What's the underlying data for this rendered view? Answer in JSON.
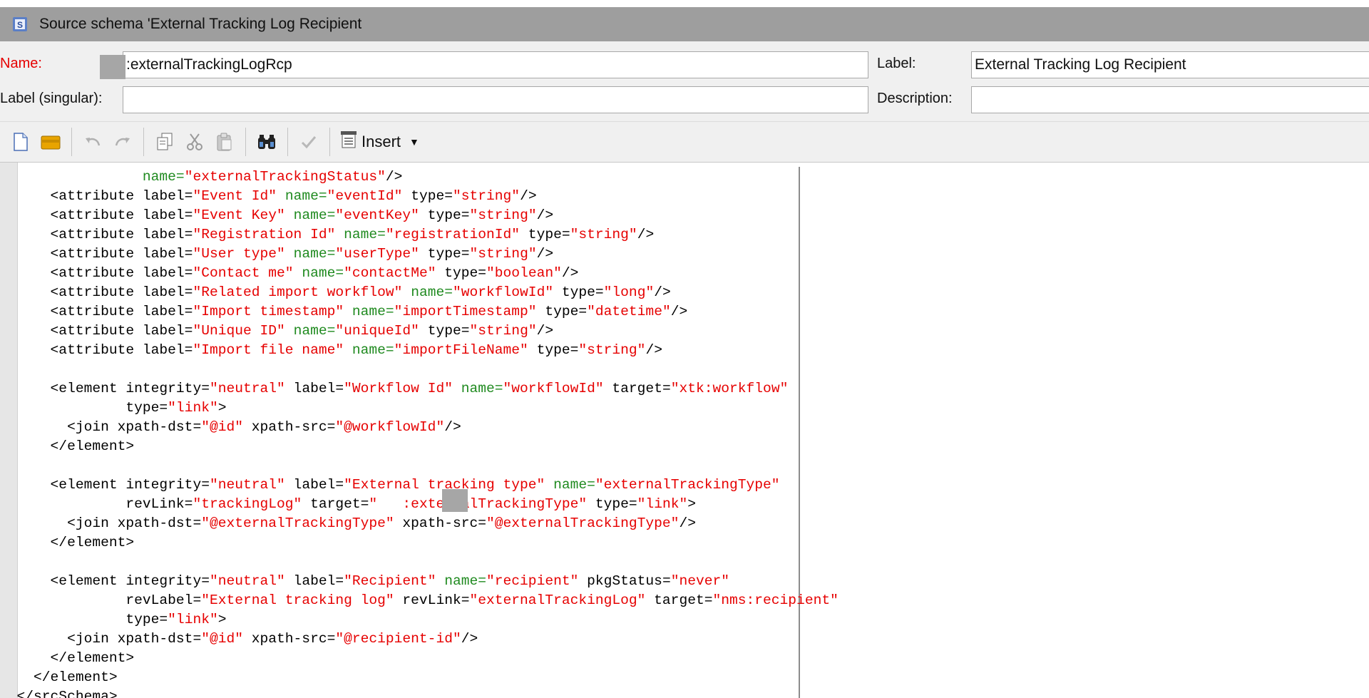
{
  "window": {
    "title": "Source schema 'External Tracking Log Recipient",
    "icon": "schema-icon"
  },
  "form": {
    "name_label": "Name:",
    "name_value": ":externalTrackingLogRcp",
    "label_label": "Label:",
    "label_value": "External Tracking Log Recipient",
    "singular_label": "Label (singular):",
    "singular_value": "",
    "description_label": "Description:",
    "description_value": ""
  },
  "toolbar": {
    "insert_label": "Insert",
    "buttons": [
      "new-icon",
      "open-icon",
      "undo-icon",
      "redo-icon",
      "copy-icon",
      "cut-icon",
      "paste-icon",
      "find-icon",
      "check-icon",
      "insert-icon"
    ]
  },
  "colors": {
    "attribute_name": "#1f8a1f",
    "attribute_value": "#e60000",
    "title_bar": "#9e9e9e",
    "name_label": "#e60000"
  },
  "code_lines": [
    [
      [
        "t",
        "                 "
      ],
      [
        "a",
        "name="
      ],
      [
        "v",
        "\"externalTrackingStatus\""
      ],
      [
        "t",
        "/>"
      ]
    ],
    [
      [
        "t",
        "      <attribute "
      ],
      [
        "t",
        "label="
      ],
      [
        "v",
        "\"Event Id\""
      ],
      [
        "t",
        " "
      ],
      [
        "a",
        "name="
      ],
      [
        "v",
        "\"eventId\""
      ],
      [
        "t",
        " type="
      ],
      [
        "v",
        "\"string\""
      ],
      [
        "t",
        "/>"
      ]
    ],
    [
      [
        "t",
        "      <attribute "
      ],
      [
        "t",
        "label="
      ],
      [
        "v",
        "\"Event Key\""
      ],
      [
        "t",
        " "
      ],
      [
        "a",
        "name="
      ],
      [
        "v",
        "\"eventKey\""
      ],
      [
        "t",
        " type="
      ],
      [
        "v",
        "\"string\""
      ],
      [
        "t",
        "/>"
      ]
    ],
    [
      [
        "t",
        "      <attribute "
      ],
      [
        "t",
        "label="
      ],
      [
        "v",
        "\"Registration Id\""
      ],
      [
        "t",
        " "
      ],
      [
        "a",
        "name="
      ],
      [
        "v",
        "\"registrationId\""
      ],
      [
        "t",
        " type="
      ],
      [
        "v",
        "\"string\""
      ],
      [
        "t",
        "/>"
      ]
    ],
    [
      [
        "t",
        "      <attribute "
      ],
      [
        "t",
        "label="
      ],
      [
        "v",
        "\"User type\""
      ],
      [
        "t",
        " "
      ],
      [
        "a",
        "name="
      ],
      [
        "v",
        "\"userType\""
      ],
      [
        "t",
        " type="
      ],
      [
        "v",
        "\"string\""
      ],
      [
        "t",
        "/>"
      ]
    ],
    [
      [
        "t",
        "      <attribute "
      ],
      [
        "t",
        "label="
      ],
      [
        "v",
        "\"Contact me\""
      ],
      [
        "t",
        " "
      ],
      [
        "a",
        "name="
      ],
      [
        "v",
        "\"contactMe\""
      ],
      [
        "t",
        " type="
      ],
      [
        "v",
        "\"boolean\""
      ],
      [
        "t",
        "/>"
      ]
    ],
    [
      [
        "t",
        "      <attribute "
      ],
      [
        "t",
        "label="
      ],
      [
        "v",
        "\"Related import workflow\""
      ],
      [
        "t",
        " "
      ],
      [
        "a",
        "name="
      ],
      [
        "v",
        "\"workflowId\""
      ],
      [
        "t",
        " type="
      ],
      [
        "v",
        "\"long\""
      ],
      [
        "t",
        "/>"
      ]
    ],
    [
      [
        "t",
        "      <attribute "
      ],
      [
        "t",
        "label="
      ],
      [
        "v",
        "\"Import timestamp\""
      ],
      [
        "t",
        " "
      ],
      [
        "a",
        "name="
      ],
      [
        "v",
        "\"importTimestamp\""
      ],
      [
        "t",
        " type="
      ],
      [
        "v",
        "\"datetime\""
      ],
      [
        "t",
        "/>"
      ]
    ],
    [
      [
        "t",
        "      <attribute "
      ],
      [
        "t",
        "label="
      ],
      [
        "v",
        "\"Unique ID\""
      ],
      [
        "t",
        " "
      ],
      [
        "a",
        "name="
      ],
      [
        "v",
        "\"uniqueId\""
      ],
      [
        "t",
        " type="
      ],
      [
        "v",
        "\"string\""
      ],
      [
        "t",
        "/>"
      ]
    ],
    [
      [
        "t",
        "      <attribute "
      ],
      [
        "t",
        "label="
      ],
      [
        "v",
        "\"Import file name\""
      ],
      [
        "t",
        " "
      ],
      [
        "a",
        "name="
      ],
      [
        "v",
        "\"importFileName\""
      ],
      [
        "t",
        " type="
      ],
      [
        "v",
        "\"string\""
      ],
      [
        "t",
        "/>"
      ]
    ],
    [
      [
        "t",
        ""
      ]
    ],
    [
      [
        "t",
        "      <element integrity="
      ],
      [
        "v",
        "\"neutral\""
      ],
      [
        "t",
        " label="
      ],
      [
        "v",
        "\"Workflow Id\""
      ],
      [
        "t",
        " "
      ],
      [
        "a",
        "name="
      ],
      [
        "v",
        "\"workflowId\""
      ],
      [
        "t",
        " target="
      ],
      [
        "v",
        "\"xtk:workflow\""
      ]
    ],
    [
      [
        "t",
        "               type="
      ],
      [
        "v",
        "\"link\""
      ],
      [
        "t",
        ">"
      ]
    ],
    [
      [
        "t",
        "        <join xpath-dst="
      ],
      [
        "v",
        "\"@id\""
      ],
      [
        "t",
        " xpath-src="
      ],
      [
        "v",
        "\"@workflowId\""
      ],
      [
        "t",
        "/>"
      ]
    ],
    [
      [
        "t",
        "      </element>"
      ]
    ],
    [
      [
        "t",
        ""
      ]
    ],
    [
      [
        "t",
        "      <element integrity="
      ],
      [
        "v",
        "\"neutral\""
      ],
      [
        "t",
        " label="
      ],
      [
        "v",
        "\"External tracking type\""
      ],
      [
        "t",
        " "
      ],
      [
        "a",
        "name="
      ],
      [
        "v",
        "\"externalTrackingType\""
      ]
    ],
    [
      [
        "t",
        "               revLink="
      ],
      [
        "v",
        "\"trackingLog\""
      ],
      [
        "t",
        " target="
      ],
      [
        "v",
        "\"   :externalTrackingType\""
      ],
      [
        "t",
        " type="
      ],
      [
        "v",
        "\"link\""
      ],
      [
        "t",
        ">"
      ]
    ],
    [
      [
        "t",
        "        <join xpath-dst="
      ],
      [
        "v",
        "\"@externalTrackingType\""
      ],
      [
        "t",
        " xpath-src="
      ],
      [
        "v",
        "\"@externalTrackingType\""
      ],
      [
        "t",
        "/>"
      ]
    ],
    [
      [
        "t",
        "      </element>"
      ]
    ],
    [
      [
        "t",
        ""
      ]
    ],
    [
      [
        "t",
        "      <element integrity="
      ],
      [
        "v",
        "\"neutral\""
      ],
      [
        "t",
        " label="
      ],
      [
        "v",
        "\"Recipient\""
      ],
      [
        "t",
        " "
      ],
      [
        "a",
        "name="
      ],
      [
        "v",
        "\"recipient\""
      ],
      [
        "t",
        " pkgStatus="
      ],
      [
        "v",
        "\"never\""
      ]
    ],
    [
      [
        "t",
        "               revLabel="
      ],
      [
        "v",
        "\"External tracking log\""
      ],
      [
        "t",
        " revLink="
      ],
      [
        "v",
        "\"externalTrackingLog\""
      ],
      [
        "t",
        " target="
      ],
      [
        "v",
        "\"nms:recipient\""
      ]
    ],
    [
      [
        "t",
        "               type="
      ],
      [
        "v",
        "\"link\""
      ],
      [
        "t",
        ">"
      ]
    ],
    [
      [
        "t",
        "        <join xpath-dst="
      ],
      [
        "v",
        "\"@id\""
      ],
      [
        "t",
        " xpath-src="
      ],
      [
        "v",
        "\"@recipient-id\""
      ],
      [
        "t",
        "/>"
      ]
    ],
    [
      [
        "t",
        "      </element>"
      ]
    ],
    [
      [
        "t",
        "    </element>"
      ]
    ],
    [
      [
        "t",
        "  </srcSchema>"
      ]
    ]
  ]
}
